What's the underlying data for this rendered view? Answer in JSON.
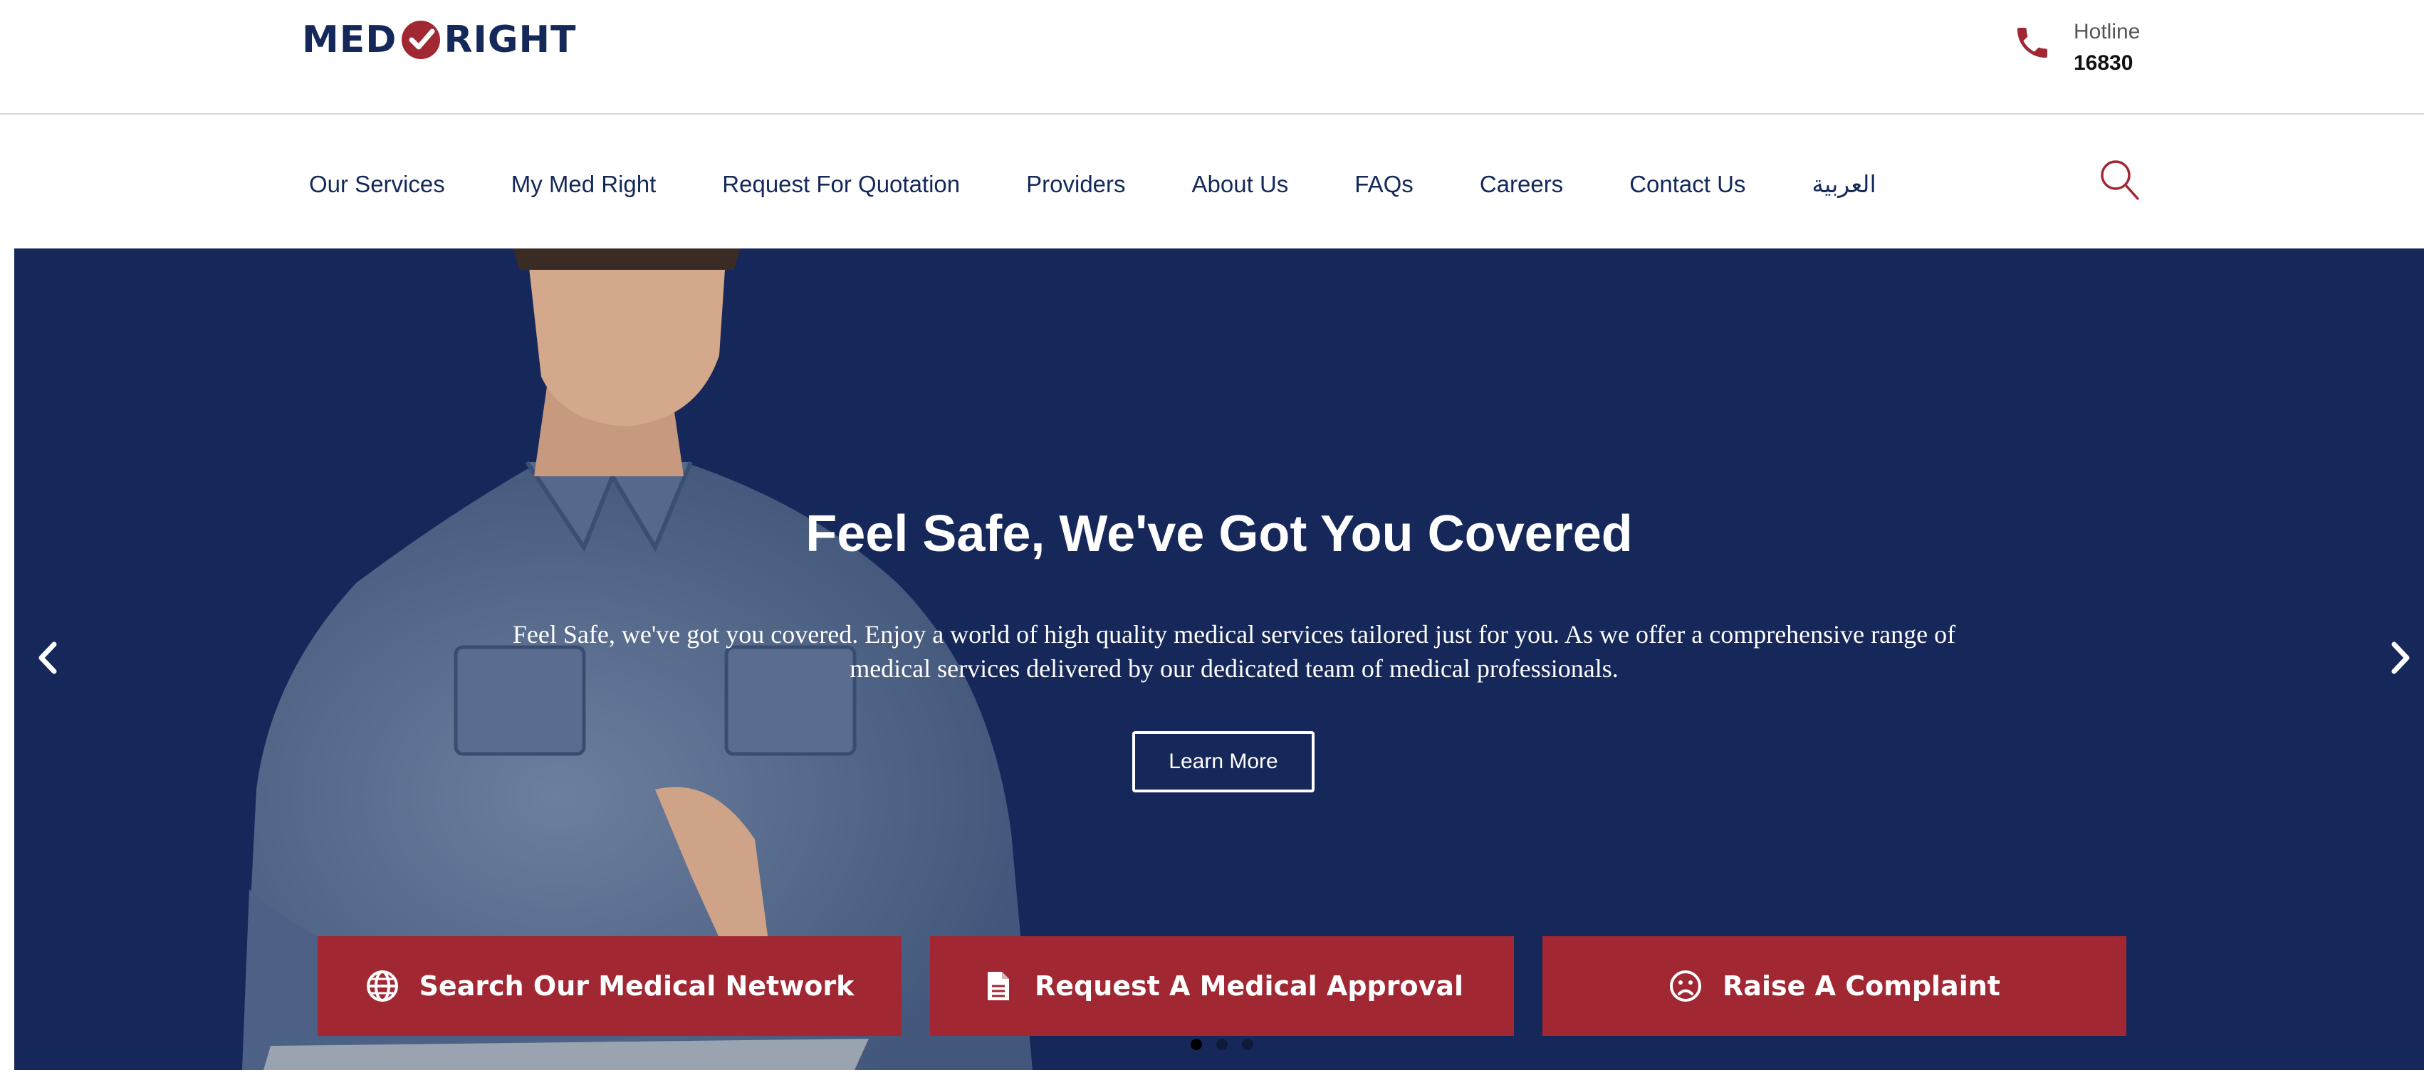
{
  "brand": {
    "logo_left": "MED",
    "logo_right": "RIGHT",
    "colors": {
      "navy": "#14295a",
      "red": "#a12733"
    }
  },
  "hotline": {
    "label": "Hotline",
    "number": "16830",
    "icon": "phone-icon"
  },
  "nav": {
    "items": [
      "Our Services",
      "My Med Right",
      "Request For Quotation",
      "Providers",
      "About Us",
      "FAQs",
      "Careers",
      "Contact Us",
      "العربية"
    ],
    "search_icon": "search-icon"
  },
  "hero": {
    "title": "Feel Safe, We've Got You Covered",
    "description": "Feel Safe, we've got you covered. Enjoy a world of high quality medical services tailored just for you. As we offer a comprehensive range of medical services delivered by our dedicated team of medical professionals.",
    "cta": "Learn More",
    "slides_total": 3,
    "active_slide": 1
  },
  "actions": [
    {
      "label": "Search Our Medical Network",
      "icon": "globe-icon"
    },
    {
      "label": "Request A Medical Approval",
      "icon": "document-icon"
    },
    {
      "label": "Raise A Complaint",
      "icon": "sad-face-icon"
    }
  ]
}
